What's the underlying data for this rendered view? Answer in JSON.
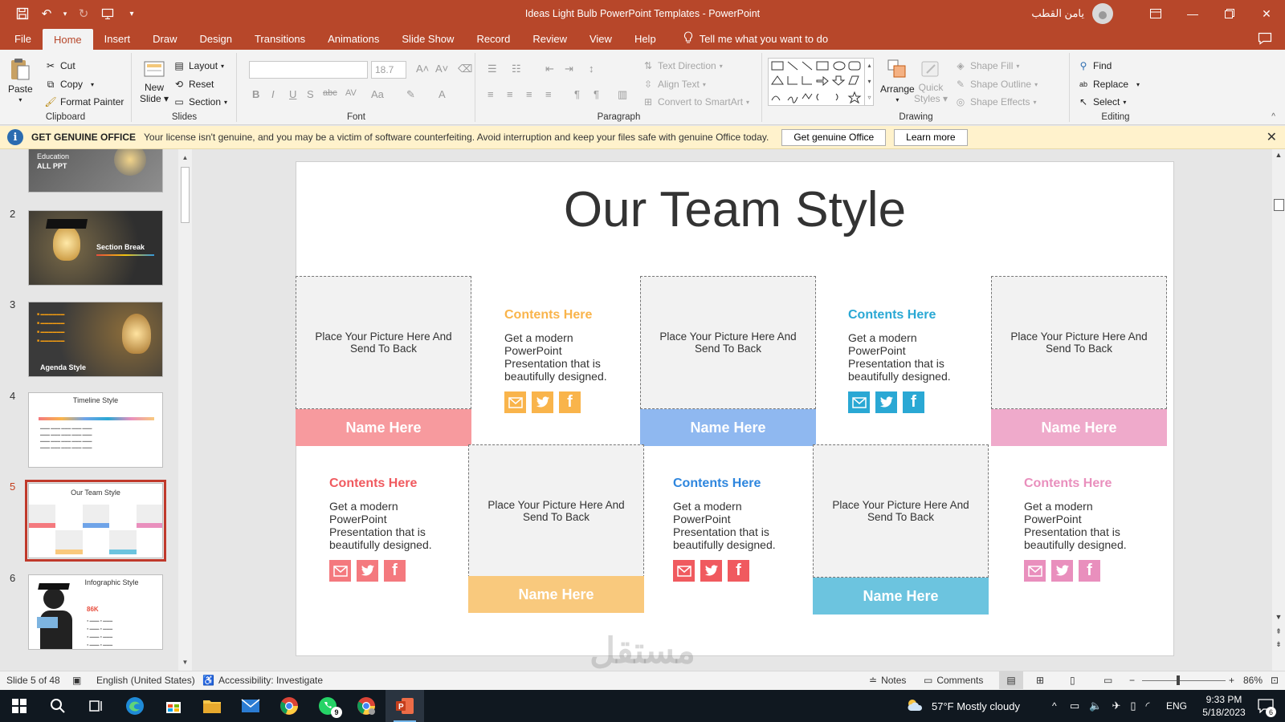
{
  "window": {
    "title": "Ideas Light Bulb PowerPoint Templates  -  PowerPoint",
    "user_name": "يامن القطب",
    "colors": {
      "accent": "#b7472a"
    }
  },
  "tabs": [
    "File",
    "Home",
    "Insert",
    "Draw",
    "Design",
    "Transitions",
    "Animations",
    "Slide Show",
    "Record",
    "Review",
    "View",
    "Help"
  ],
  "active_tab": "Home",
  "tell_me": "Tell me what you want to do",
  "ribbon": {
    "clipboard": {
      "label": "Clipboard",
      "paste": "Paste",
      "cut": "Cut",
      "copy": "Copy",
      "format_painter": "Format Painter"
    },
    "slides": {
      "label": "Slides",
      "new_slide_1": "New",
      "new_slide_2": "Slide",
      "layout": "Layout",
      "reset": "Reset",
      "section": "Section"
    },
    "font": {
      "label": "Font",
      "size": "18.7"
    },
    "paragraph": {
      "label": "Paragraph",
      "text_direction": "Text Direction",
      "align_text": "Align Text",
      "convert_smartart": "Convert to SmartArt"
    },
    "drawing": {
      "label": "Drawing",
      "arrange": "Arrange",
      "quick_styles_1": "Quick",
      "quick_styles_2": "Styles",
      "shape_fill": "Shape Fill",
      "shape_outline": "Shape Outline",
      "shape_effects": "Shape Effects"
    },
    "editing": {
      "label": "Editing",
      "find": "Find",
      "replace": "Replace",
      "select": "Select"
    }
  },
  "message_bar": {
    "title": "GET GENUINE OFFICE",
    "text": "Your license isn't genuine, and you may be a victim of software counterfeiting. Avoid interruption and keep your files safe with genuine Office today.",
    "button_primary": "Get genuine Office",
    "button_secondary": "Learn more"
  },
  "thumbnails": [
    {
      "num": "",
      "line1": "Education",
      "line2": "ALL PPT"
    },
    {
      "num": "2",
      "text": "Section Break"
    },
    {
      "num": "3",
      "text": "Agenda Style"
    },
    {
      "num": "4",
      "text": "Timeline Style"
    },
    {
      "num": "5",
      "text": "Our Team Style"
    },
    {
      "num": "6",
      "text": "Infographic Style",
      "stat": "86K"
    }
  ],
  "slide": {
    "title": "Our Team Style",
    "picture_placeholder": "Place Your Picture Here And Send To Back",
    "name": "Name Here",
    "contents_title": "Contents Here",
    "contents_body": "Get a modern PowerPoint Presentation that is beautifully designed.",
    "colors": {
      "red": "#f4797e",
      "orange": "#f9b44b",
      "blue": "#6fa4e8",
      "teal": "#2aa8d4",
      "pink": "#e98fbd",
      "sky": "#6cc4df",
      "peach": "#f9c97d"
    }
  },
  "status_bar": {
    "slide_info": "Slide 5 of 48",
    "language": "English (United States)",
    "accessibility": "Accessibility: Investigate",
    "notes": "Notes",
    "comments": "Comments",
    "zoom": "86%"
  },
  "taskbar": {
    "weather": "57°F  Mostly cloudy",
    "lang": "ENG",
    "time": "9:33 PM",
    "date": "5/18/2023",
    "whatsapp_badge": "9",
    "notif_badge": "6"
  },
  "watermark": {
    "line1": "مستقل",
    "line2": "mostaqi.com"
  }
}
